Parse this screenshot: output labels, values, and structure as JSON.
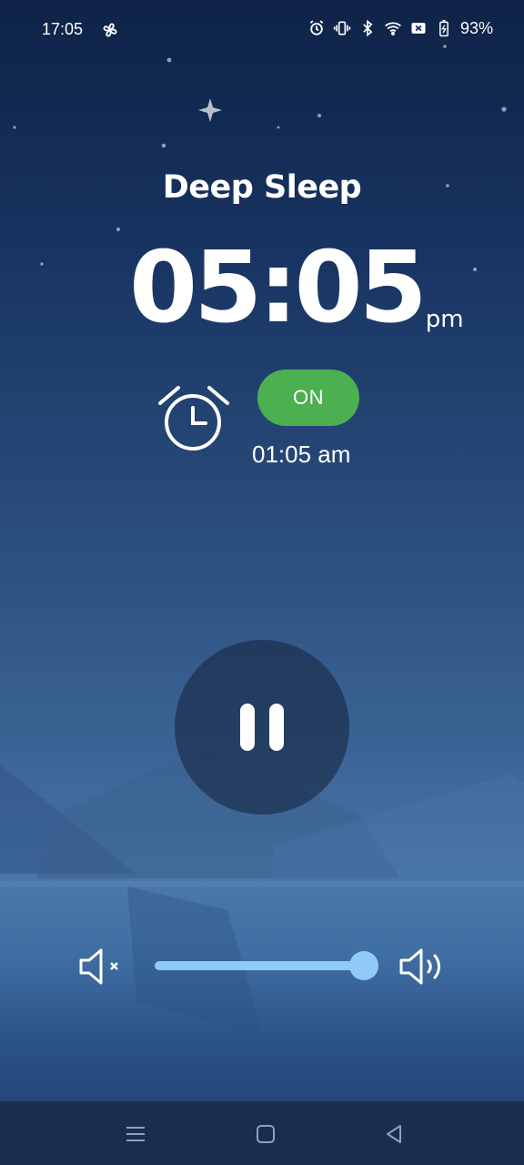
{
  "status_bar": {
    "time": "17:05",
    "battery_percent": "93%",
    "icons": [
      "fan-icon",
      "alarm-clock-icon",
      "vibrate-icon",
      "bluetooth-icon",
      "wifi-icon",
      "no-sim-icon",
      "battery-icon"
    ]
  },
  "player": {
    "title": "Deep Sleep",
    "clock": "05:05",
    "ampm": "pm",
    "alarm_toggle": "ON",
    "alarm_time": "01:05 am",
    "play_state": "pause-icon"
  },
  "volume": {
    "level": 0.99,
    "min_icon": "volume-mute-icon",
    "max_icon": "volume-max-icon"
  },
  "navigation": {
    "buttons": [
      "menu-icon",
      "home-icon",
      "back-icon"
    ]
  },
  "colors": {
    "toggle_on": "#4caf50",
    "volume_accent": "#90caf9"
  }
}
